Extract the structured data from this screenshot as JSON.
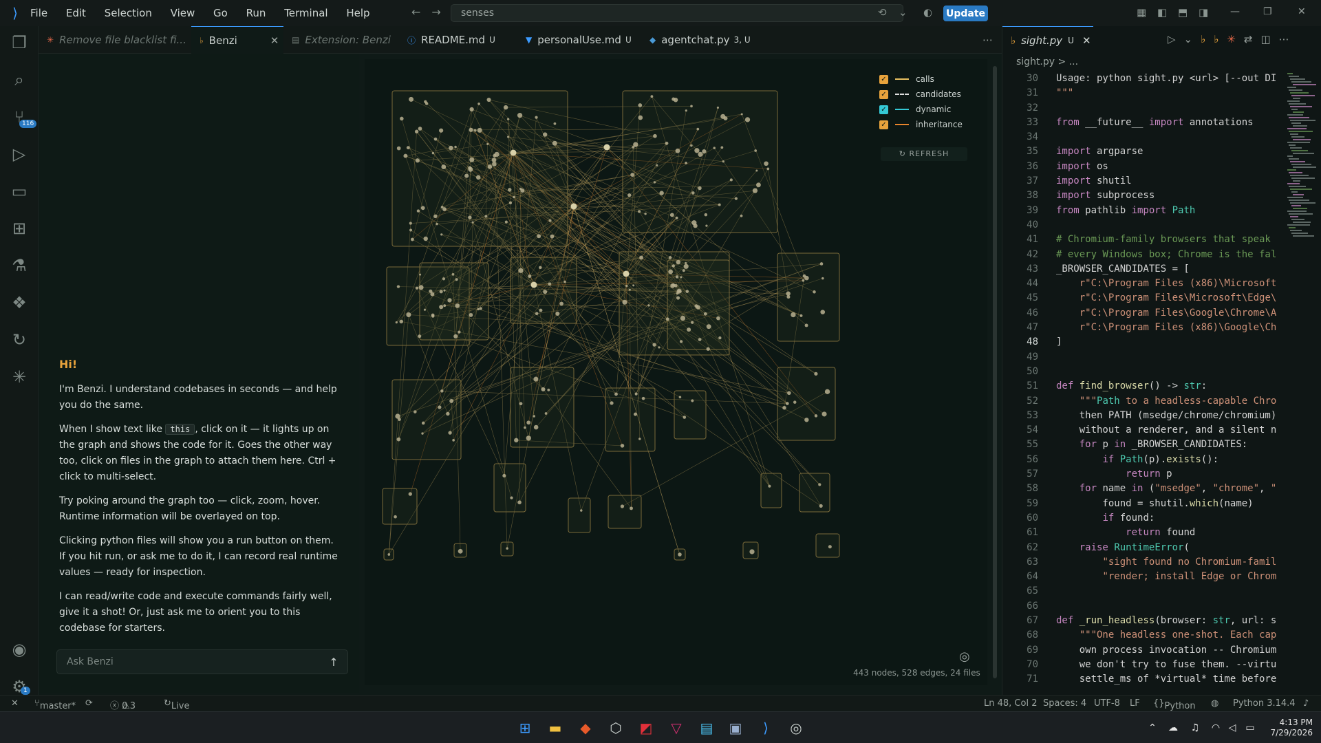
{
  "titlebar": {
    "menu": [
      "File",
      "Edit",
      "Selection",
      "View",
      "Go",
      "Run",
      "Terminal",
      "Help"
    ],
    "search_text": "senses",
    "update_label": "Update"
  },
  "activity": {
    "source_control_badge": "116",
    "settings_badge": "1"
  },
  "tabs": [
    {
      "label": "Remove file blacklist fi...",
      "modified": ""
    },
    {
      "label": "Benzi",
      "modified": ""
    },
    {
      "label": "Extension: Benzi",
      "modified": ""
    },
    {
      "label": "README.md",
      "modified": "U"
    },
    {
      "label": "personalUse.md",
      "modified": "U"
    },
    {
      "label": "agentchat.py",
      "modified": "3, U"
    }
  ],
  "chat": {
    "greeting": "Hi!",
    "p1": "I'm Benzi. I understand codebases in seconds — and help you do the same.",
    "p2_a": "When I show text like ",
    "p2_code": "this",
    "p2_b": ", click on it — it lights up on the graph and shows the code for it. Goes the other way too, click on files in the graph to attach them here. Ctrl + click to multi-select.",
    "p3": "Try poking around the graph too — click, zoom, hover. Runtime information will be overlayed on top.",
    "p4": "Clicking python files will show you a run button on them. If you hit run, or ask me to do it, I can record real runtime values — ready for inspection.",
    "p5": "I can read/write code and execute commands fairly well, give it a shot! Or, just ask me to orient you to this codebase for starters.",
    "input_placeholder": "Ask Benzi"
  },
  "graph": {
    "legend": [
      {
        "label": "calls",
        "checkbox_color": "#e8a33c",
        "line_color": "#e8c060",
        "style": "solid"
      },
      {
        "label": "candidates",
        "checkbox_color": "#e8a33c",
        "line_color": "#e0e0e0",
        "style": "dashed"
      },
      {
        "label": "dynamic",
        "checkbox_color": "#35c9d6",
        "line_color": "#35c9d6",
        "style": "solid"
      },
      {
        "label": "inheritance",
        "checkbox_color": "#e8a33c",
        "line_color": "#e8842c",
        "style": "solid"
      }
    ],
    "refresh_label": "↻ REFRESH",
    "stats": "443 nodes, 528 edges, 24 files"
  },
  "editor": {
    "tab_label": "sight.py",
    "tab_modified": "U",
    "breadcrumb": "sight.py > ...",
    "lines": [
      {
        "no": "30",
        "text": "Usage: python sight.py <url> [--out DI"
      },
      {
        "no": "31",
        "text": "\"\"\""
      },
      {
        "no": "32",
        "text": ""
      },
      {
        "no": "33",
        "text": "from __future__ import annotations"
      },
      {
        "no": "34",
        "text": ""
      },
      {
        "no": "35",
        "text": "import argparse"
      },
      {
        "no": "36",
        "text": "import os"
      },
      {
        "no": "37",
        "text": "import shutil"
      },
      {
        "no": "38",
        "text": "import subprocess"
      },
      {
        "no": "39",
        "text": "from pathlib import Path"
      },
      {
        "no": "40",
        "text": ""
      },
      {
        "no": "41",
        "text": "# Chromium-family browsers that speak"
      },
      {
        "no": "42",
        "text": "# every Windows box; Chrome is the fal"
      },
      {
        "no": "43",
        "text": "_BROWSER_CANDIDATES = ["
      },
      {
        "no": "44",
        "text": "    r\"C:\\Program Files (x86)\\Microsoft"
      },
      {
        "no": "45",
        "text": "    r\"C:\\Program Files\\Microsoft\\Edge\\"
      },
      {
        "no": "46",
        "text": "    r\"C:\\Program Files\\Google\\Chrome\\A"
      },
      {
        "no": "47",
        "text": "    r\"C:\\Program Files (x86)\\Google\\Ch"
      },
      {
        "no": "48",
        "text": "]"
      },
      {
        "no": "49",
        "text": ""
      },
      {
        "no": "50",
        "text": ""
      },
      {
        "no": "51",
        "text": "def find_browser() -> str:"
      },
      {
        "no": "52",
        "text": "    \"\"\"Path to a headless-capable Chro"
      },
      {
        "no": "53",
        "text": "    then PATH (msedge/chrome/chromium)"
      },
      {
        "no": "54",
        "text": "    without a renderer, and a silent n"
      },
      {
        "no": "55",
        "text": "    for p in _BROWSER_CANDIDATES:"
      },
      {
        "no": "56",
        "text": "        if Path(p).exists():"
      },
      {
        "no": "57",
        "text": "            return p"
      },
      {
        "no": "58",
        "text": "    for name in (\"msedge\", \"chrome\", \""
      },
      {
        "no": "59",
        "text": "        found = shutil.which(name)"
      },
      {
        "no": "60",
        "text": "        if found:"
      },
      {
        "no": "61",
        "text": "            return found"
      },
      {
        "no": "62",
        "text": "    raise RuntimeError("
      },
      {
        "no": "63",
        "text": "        \"sight found no Chromium-famil"
      },
      {
        "no": "64",
        "text": "        \"render; install Edge or Chrom"
      },
      {
        "no": "65",
        "text": ""
      },
      {
        "no": "66",
        "text": ""
      },
      {
        "no": "67",
        "text": "def _run_headless(browser: str, url: s"
      },
      {
        "no": "68",
        "text": "    \"\"\"One headless one-shot. Each cap"
      },
      {
        "no": "69",
        "text": "    own process invocation -- Chromium"
      },
      {
        "no": "70",
        "text": "    we don't try to fuse them. --virtu"
      },
      {
        "no": "71",
        "text": "    settle_ms of *virtual* time before"
      }
    ]
  },
  "status": {
    "branch": "master*",
    "errors": "0",
    "warnings": "3",
    "live_share": "Live Share",
    "position": "Ln 48, Col 2",
    "spaces": "Spaces: 4",
    "encoding": "UTF-8",
    "eol": "LF",
    "language": "Python",
    "interpreter": "Python 3.14.4"
  },
  "taskbar": {
    "time": "4:13 PM",
    "date": "7/29/2026"
  }
}
